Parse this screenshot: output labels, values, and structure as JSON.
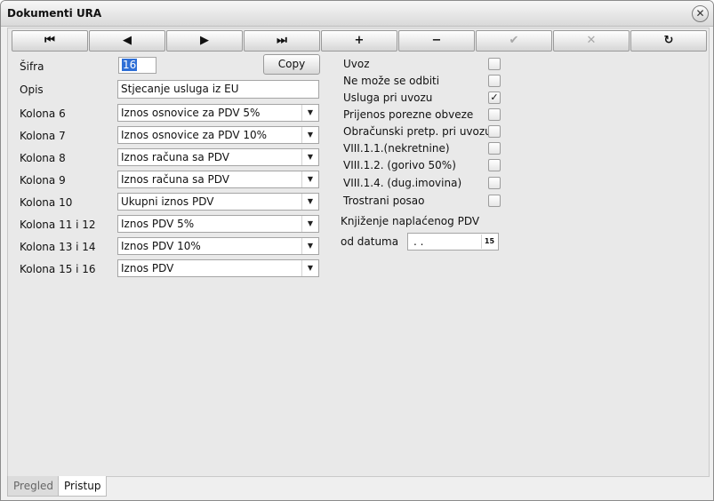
{
  "window": {
    "title": "Dokumenti URA",
    "close_symbol": "✕"
  },
  "toolbar": {
    "first": "⏮",
    "prev": "◀",
    "next": "▶",
    "last": "⏭",
    "add": "+",
    "remove": "−",
    "confirm": "✔",
    "cancel": "✕",
    "refresh": "↻"
  },
  "form": {
    "sifra_label": "Šifra",
    "sifra_value": "16",
    "copy_label": "Copy",
    "opis_label": "Opis",
    "opis_value": "Stjecanje usluga iz EU",
    "columns": [
      {
        "label": "Kolona 6",
        "value": "Iznos osnovice za PDV 5%"
      },
      {
        "label": "Kolona 7",
        "value": "Iznos osnovice za PDV 10%"
      },
      {
        "label": "Kolona 8",
        "value": "Iznos računa sa PDV"
      },
      {
        "label": "Kolona 9",
        "value": "Iznos računa sa PDV"
      },
      {
        "label": "Kolona 10",
        "value": "Ukupni iznos PDV"
      },
      {
        "label": "Kolona 11 i 12",
        "value": "Iznos PDV 5%"
      },
      {
        "label": "Kolona 13 i 14",
        "value": "Iznos PDV 10%"
      },
      {
        "label": "Kolona 15 i 16",
        "value": "Iznos PDV"
      }
    ],
    "dropdown_arrow": "▼"
  },
  "options": [
    {
      "label": "Uvoz",
      "checked": false
    },
    {
      "label": "Ne može se odbiti",
      "checked": false
    },
    {
      "label": "Usluga pri uvozu",
      "checked": true
    },
    {
      "label": "Prijenos porezne obveze",
      "checked": false
    },
    {
      "label": "Obračunski pretp. pri uvozu",
      "checked": false
    },
    {
      "label": "VIII.1.1.(nekretnine)",
      "checked": false
    },
    {
      "label": "VIII.1.2. (gorivo 50%)",
      "checked": false
    },
    {
      "label": "VIII.1.4. (dug.imovina)",
      "checked": false
    },
    {
      "label": "Trostrani posao",
      "checked": false
    }
  ],
  "check_mark": "✓",
  "knjizenje": {
    "heading": "Knjiženje naplaćenog PDV",
    "date_label": "od datuma",
    "date_value": " .  .",
    "calendar_glyph": "15"
  },
  "tabs": [
    {
      "label": "Pregled",
      "active": false
    },
    {
      "label": "Pristup",
      "active": true
    }
  ]
}
